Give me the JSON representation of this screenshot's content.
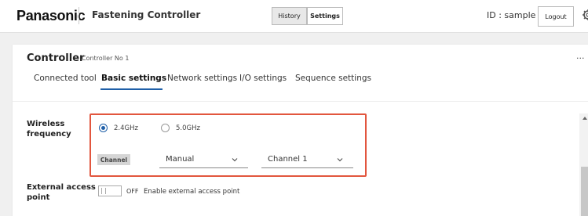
{
  "header": {
    "brand": "Panasonic",
    "app_title": "Fastening Controller",
    "history_label": "History",
    "settings_label": "Settings",
    "user_id": "ID : sample",
    "logout_label": "Logout"
  },
  "card": {
    "title": "Controller",
    "subtitle": "Controller No 1",
    "more_label": "..."
  },
  "tabs": [
    {
      "label": "Connected tool",
      "active": false
    },
    {
      "label": "Basic settings",
      "active": true
    },
    {
      "label": "Network settings",
      "active": false
    },
    {
      "label": "I/O settings",
      "active": false
    },
    {
      "label": "Sequence settings",
      "active": false
    }
  ],
  "wireless": {
    "label_line1": "Wireless",
    "label_line2": "frequency",
    "options": [
      {
        "label": "2.4GHz",
        "checked": true
      },
      {
        "label": "5.0GHz",
        "checked": false
      }
    ],
    "channel_tag": "Channel",
    "mode_value": "Manual",
    "channel_value": "Channel 1"
  },
  "external": {
    "label_line1": "External access",
    "label_line2": "point",
    "toggle_state": "OFF",
    "toggle_desc": "Enable external access point",
    "enabled": false
  },
  "colors": {
    "accent": "#1f5fa8",
    "highlight": "#e2563e"
  }
}
